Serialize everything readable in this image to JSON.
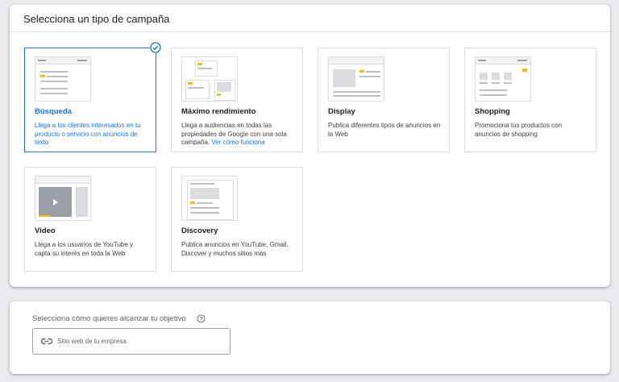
{
  "campaign_panel": {
    "title": "Selecciona un tipo de campaña",
    "cards": [
      {
        "id": "busqueda",
        "title": "Búsqueda",
        "description": "Llega a los clientes interesados en tu producto o servicio con anuncios de texto",
        "selected": true
      },
      {
        "id": "maximo",
        "title": "Máximo rendimiento",
        "description": "Llega a audiencias en todas las propiedades de Google con una sola campaña.",
        "link": "Ver cómo funciona",
        "selected": false
      },
      {
        "id": "display",
        "title": "Display",
        "description": "Publica diferentes tipos de anuncios en la Web",
        "selected": false
      },
      {
        "id": "shopping",
        "title": "Shopping",
        "description": "Promociona tus productos con anuncios de shopping",
        "selected": false
      },
      {
        "id": "video",
        "title": "Video",
        "description": "Llega a los usuarios de YouTube y capta su interés en toda la Web",
        "selected": false
      },
      {
        "id": "discovery",
        "title": "Discovery",
        "description": "Publica anuncios en YouTube, Gmail, Discover y muchos sitios más",
        "selected": false
      }
    ],
    "selected_icon": "check-circle-icon"
  },
  "goal_panel": {
    "label": "Selecciona cómo quieres alcanzar tu objetivo",
    "help_icon": "help-circle-icon",
    "field": {
      "icon": "link-icon",
      "text": "Sitio web de tu empresa"
    }
  },
  "colors": {
    "accent": "#1a73e8",
    "thumb_highlight": "#fbbc04",
    "page_bg": "#e8eaed"
  }
}
